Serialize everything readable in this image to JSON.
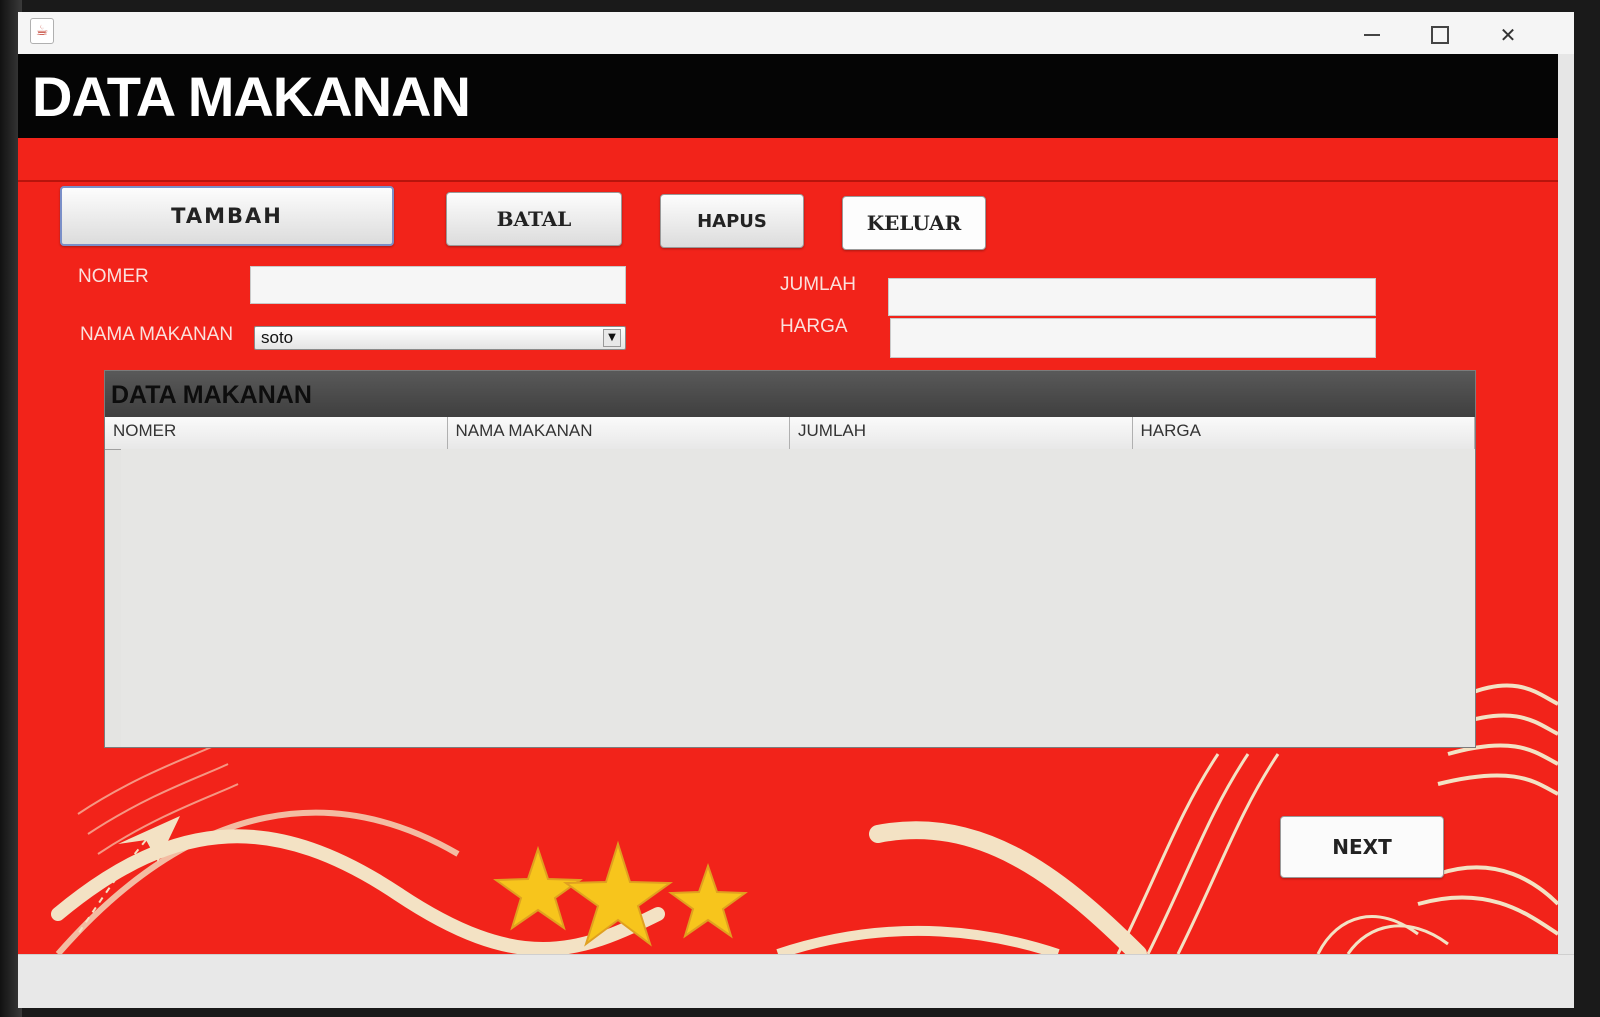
{
  "window": {
    "title_icon": "java-app-icon",
    "controls": {
      "minimize": "minimize-icon",
      "maximize": "maximize-icon",
      "close": "close-icon",
      "close_glyph": "✕"
    }
  },
  "header": {
    "title": "DATA MAKANAN"
  },
  "toolbar": {
    "tambah_label": "TAMBAH",
    "batal_label": "BATAL",
    "hapus_label": "HAPUS",
    "keluar_label": "KELUAR"
  },
  "form": {
    "nomer_label": "NOMER",
    "nomer_value": "",
    "nama_makanan_label": "NAMA MAKANAN",
    "nama_makanan_selected": "soto",
    "jumlah_label": "JUMLAH",
    "jumlah_value": "",
    "harga_label": "HARGA",
    "harga_value": ""
  },
  "table": {
    "title": "DATA MAKANAN",
    "columns": [
      "NOMER",
      "NAMA MAKANAN",
      "JUMLAH",
      "HARGA"
    ],
    "rows": []
  },
  "footer": {
    "next_label": "NEXT"
  },
  "colors": {
    "background_red": "#f2231a",
    "header_black": "#050505",
    "star_yellow": "#f7c51c",
    "cream": "#f3e2c4"
  }
}
